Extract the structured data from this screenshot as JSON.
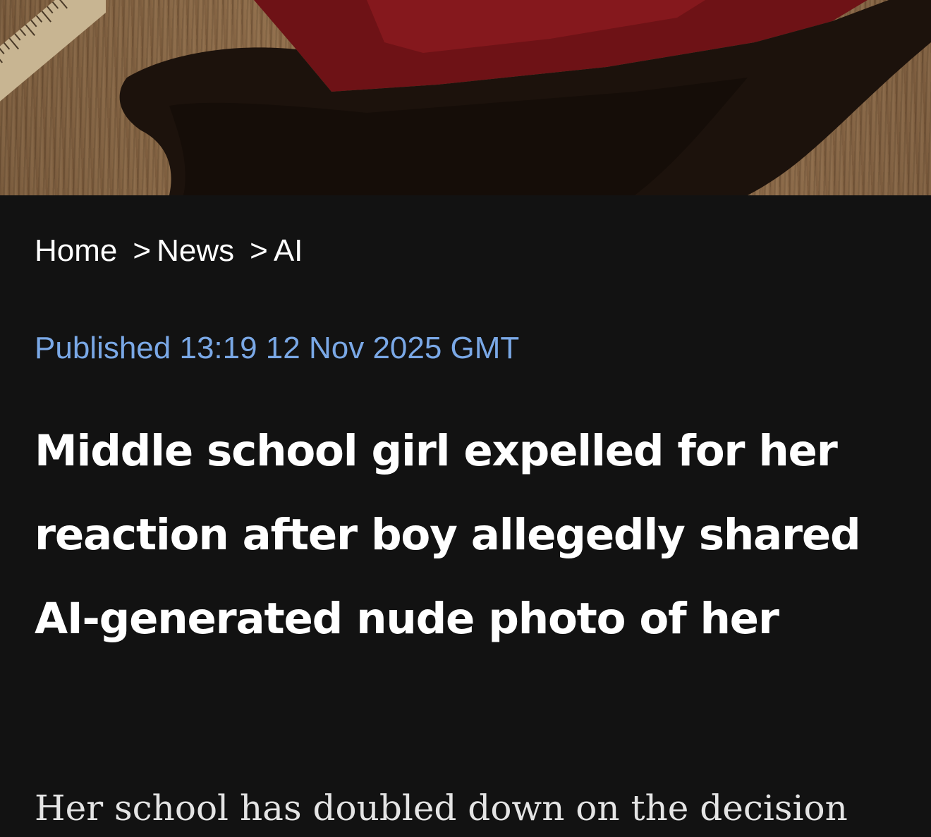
{
  "hero": {
    "icon": "hero-photo",
    "colors": {
      "wood": "#8d6b48",
      "fabric": "#7a1418",
      "shadow": "#1e120b"
    }
  },
  "breadcrumb": {
    "items": [
      {
        "label": "Home"
      },
      {
        "label": "News"
      },
      {
        "label": "AI"
      }
    ],
    "separator": ">"
  },
  "published": {
    "text": "Published 13:19 12 Nov 2025 GMT",
    "color": "#7aa8e6"
  },
  "article": {
    "headline": "Middle school girl expelled for her reaction after boy allegedly shared AI-generated nude photo of her",
    "lede": "Her school has doubled down on the decision"
  },
  "colors": {
    "background": "#121212",
    "text": "#ffffff"
  }
}
